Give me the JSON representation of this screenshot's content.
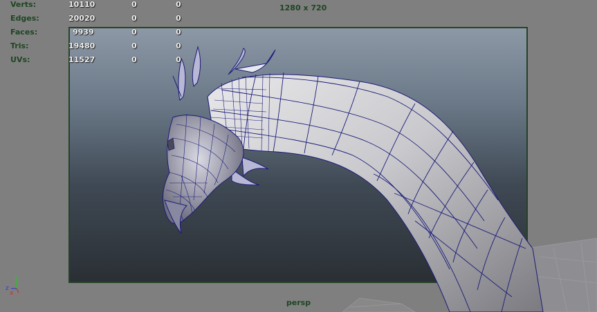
{
  "hud": {
    "stats": [
      {
        "label": "Verts:",
        "v1": "10110",
        "v2": "0",
        "v3": "0"
      },
      {
        "label": "Edges:",
        "v1": "20020",
        "v2": "0",
        "v3": "0"
      },
      {
        "label": "Faces:",
        "v1": "9939",
        "v2": "0",
        "v3": "0"
      },
      {
        "label": "Tris:",
        "v1": "19480",
        "v2": "0",
        "v3": "0"
      },
      {
        "label": "UVs:",
        "v1": "11527",
        "v2": "0",
        "v3": "0"
      }
    ],
    "resolution": "1280 x 720",
    "camera": "persp"
  },
  "axis": {
    "y": "y",
    "z": "z",
    "x": "x"
  },
  "colors": {
    "hud_label": "#1e4622",
    "gate_border": "#244226",
    "wireframe": "#1a1a78"
  }
}
